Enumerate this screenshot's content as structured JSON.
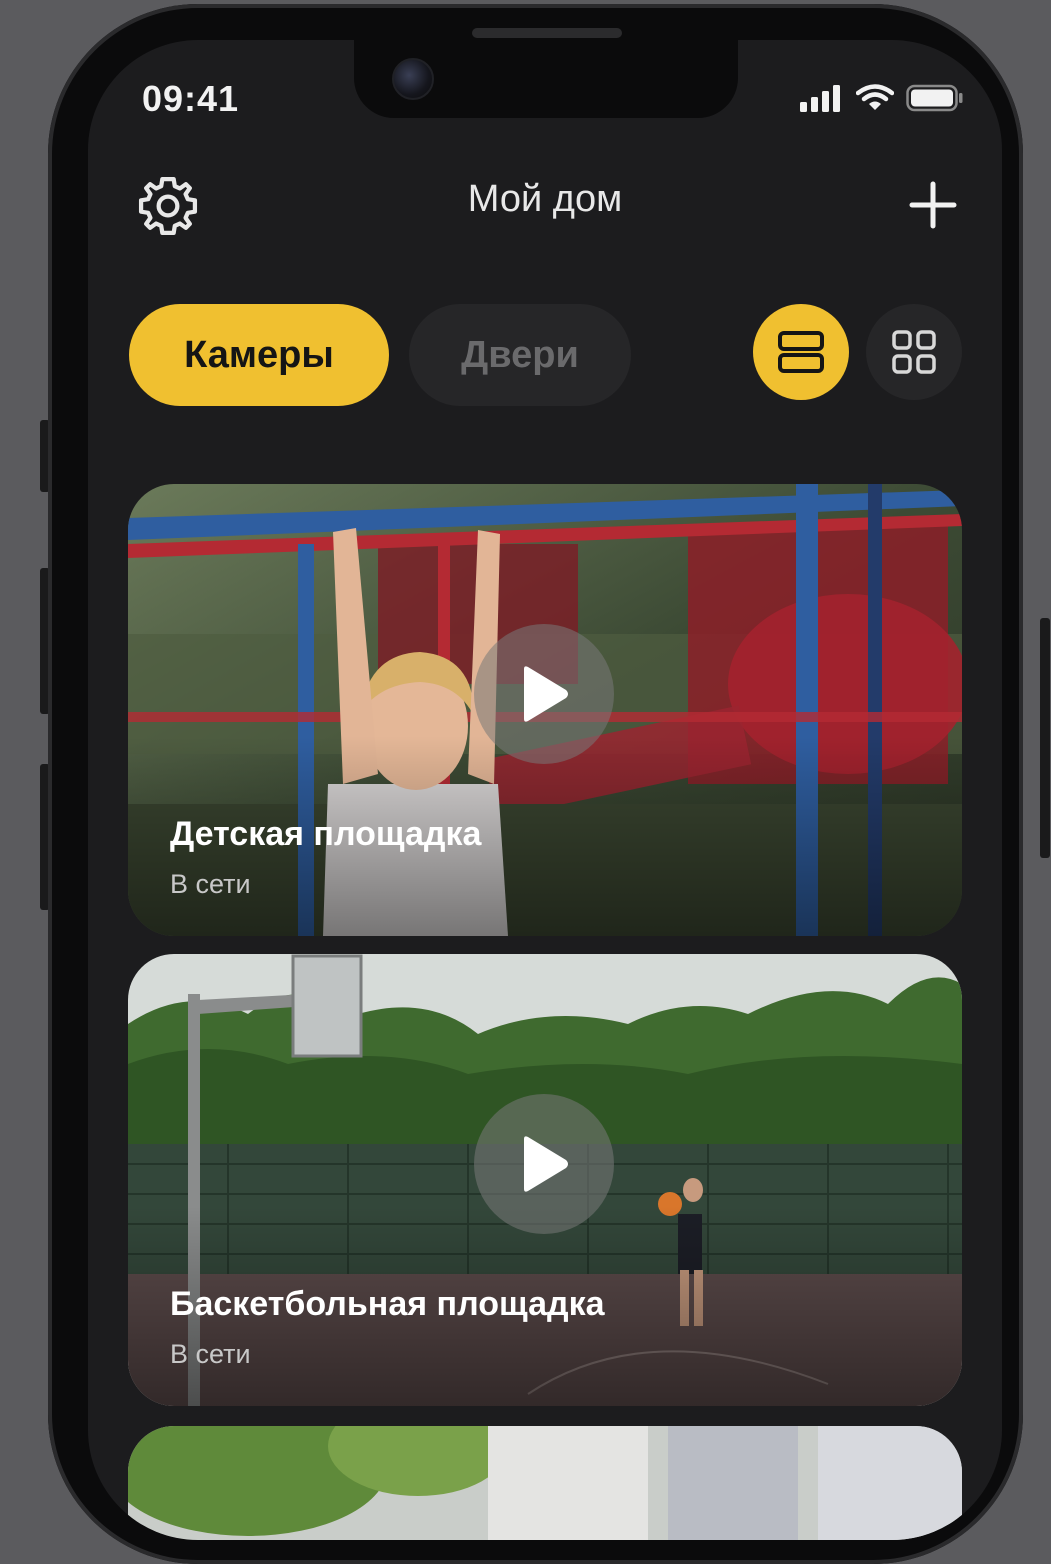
{
  "status_bar": {
    "time": "09:41"
  },
  "header": {
    "title": "Мой дом"
  },
  "tabs": [
    {
      "label": "Камеры",
      "active": true
    },
    {
      "label": "Двери",
      "active": false
    }
  ],
  "view_modes": {
    "active": "list"
  },
  "cameras": [
    {
      "title": "Детская площадка",
      "status": "В сети"
    },
    {
      "title": "Баскетбольная площадка",
      "status": "В сети"
    }
  ],
  "colors": {
    "accent": "#f0c030",
    "background": "#1c1c1e",
    "chip": "#262628"
  },
  "icons": [
    "gear-icon",
    "plus-icon",
    "list-view-icon",
    "grid-view-icon",
    "play-icon",
    "signal-icon",
    "wifi-icon",
    "battery-icon"
  ]
}
